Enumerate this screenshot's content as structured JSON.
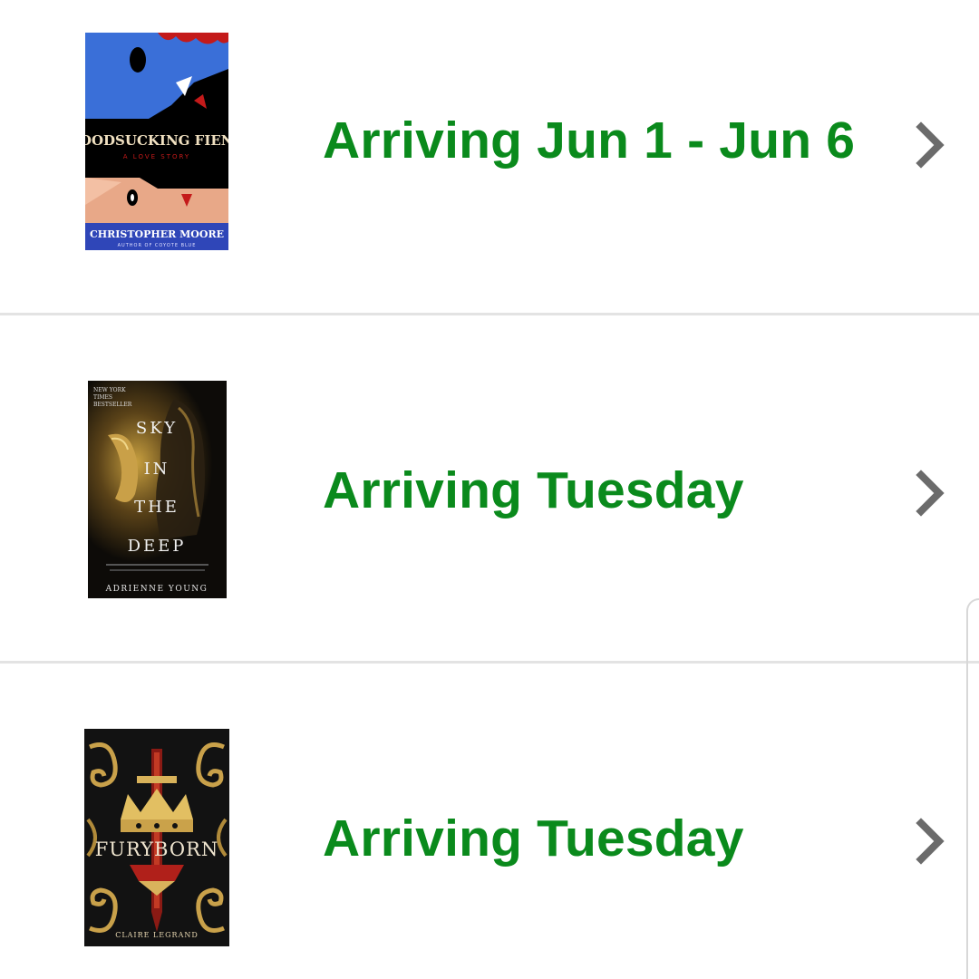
{
  "orders": [
    {
      "status": "Arriving Jun 1 - Jun 6",
      "cover": {
        "title": "BLOODSUCKING FIENDS",
        "subtitle": "A LOVE STORY",
        "author": "CHRISTOPHER MOORE",
        "tagline": "AUTHOR OF COYOTE BLUE"
      }
    },
    {
      "status": "Arriving Tuesday",
      "cover": {
        "badge": [
          "NEW YORK",
          "TIMES",
          "BESTSELLER"
        ],
        "title_lines": [
          "SKY",
          "IN",
          "THE",
          "DEEP"
        ],
        "author": "ADRIENNE YOUNG"
      }
    },
    {
      "status": "Arriving Tuesday",
      "cover": {
        "title": "FURYBORN",
        "author": "CLAIRE LEGRAND"
      }
    }
  ],
  "colors": {
    "status_green": "#0a8a1c",
    "chevron_gray": "#6b6b6b",
    "divider": "#e3e3e3"
  },
  "icons": {
    "row_chevron": "chevron-right-icon"
  }
}
